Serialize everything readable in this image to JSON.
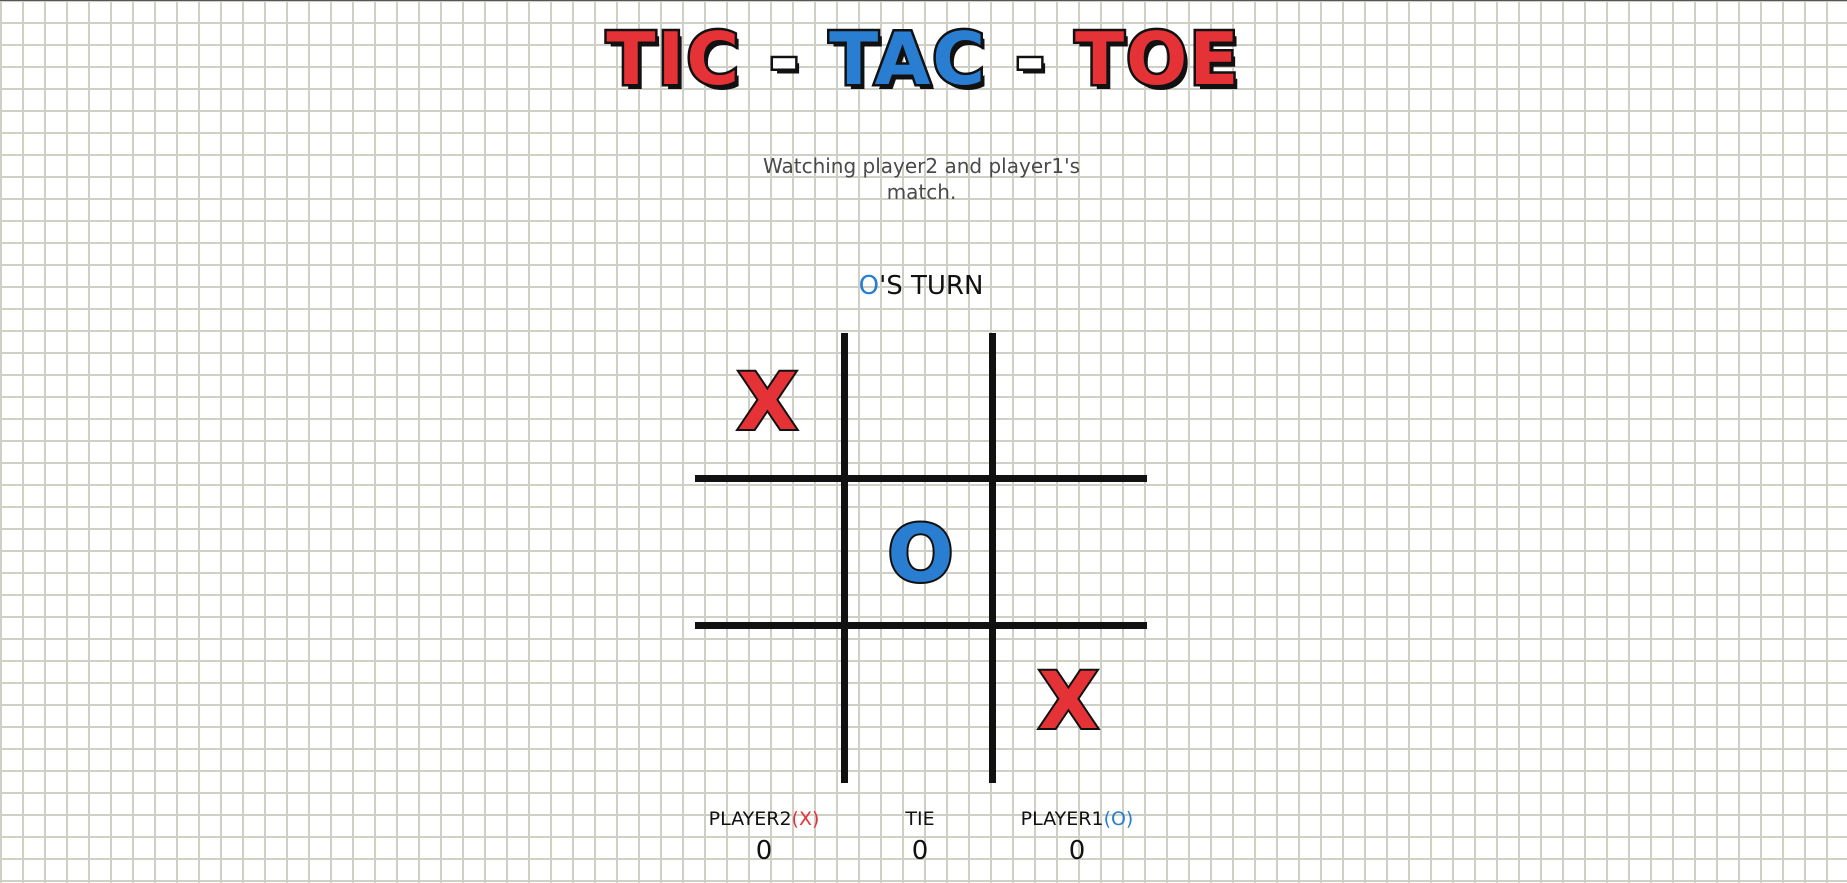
{
  "title": {
    "part1": "TIC",
    "sep1": "-",
    "part2": "TAC",
    "sep2": "-",
    "part3": "TOE"
  },
  "subtitle": "Watching player2 and player1's match.",
  "turn": {
    "mark": "O",
    "text": "'S TURN"
  },
  "board": {
    "cells": [
      "X",
      "",
      "",
      "",
      "O",
      "",
      "",
      "",
      "X"
    ]
  },
  "scores": {
    "player_x": {
      "name": "PLAYER2",
      "symbol": "(X)",
      "value": "0"
    },
    "tie": {
      "name": "TIE",
      "value": "0"
    },
    "player_o": {
      "name": "PLAYER1",
      "symbol": "(O)",
      "value": "0"
    }
  },
  "colors": {
    "x": "#e53237",
    "o": "#2a7ed1",
    "ink": "#111111",
    "grid": "#cfcfc6"
  }
}
